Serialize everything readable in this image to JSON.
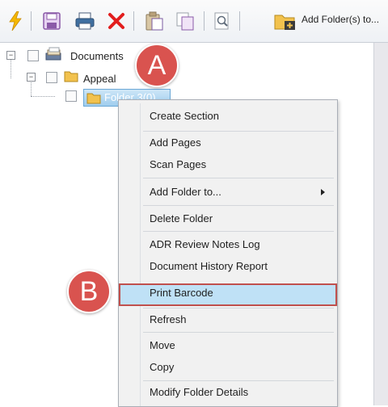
{
  "toolbar": {
    "buttons": [
      {
        "icon": "lightning-icon"
      },
      {
        "icon": "save-icon"
      },
      {
        "icon": "print-icon"
      },
      {
        "icon": "delete-icon"
      },
      {
        "icon": "paste-icon"
      },
      {
        "icon": "copy-icon"
      },
      {
        "icon": "find-icon"
      },
      {
        "icon": "add-folder-icon"
      }
    ],
    "add_folder_label": "Add Folder(s) to..."
  },
  "tree": {
    "nodes": [
      {
        "label": "Documents",
        "expander": "−"
      },
      {
        "label": "Appeal",
        "expander": "−"
      },
      {
        "label": "Folder 3(0)"
      }
    ]
  },
  "callouts": {
    "a": "A",
    "b": "B"
  },
  "context_menu": {
    "items": [
      {
        "label": "Create Section"
      },
      {
        "label": "Add Pages"
      },
      {
        "label": "Scan Pages"
      },
      {
        "label": "Add Folder to..."
      },
      {
        "label": "Delete Folder"
      },
      {
        "label": "ADR Review Notes Log"
      },
      {
        "label": "Document History Report"
      },
      {
        "label": "Print Barcode",
        "highlighted": true
      },
      {
        "label": "Refresh"
      },
      {
        "label": "Move"
      },
      {
        "label": "Copy"
      },
      {
        "label": "Modify Folder Details"
      }
    ]
  },
  "colors": {
    "callout": "#d9534f",
    "highlight_border": "#c0504d",
    "highlight_fill": "#bfe1f6",
    "selection": "#9fcdee"
  }
}
